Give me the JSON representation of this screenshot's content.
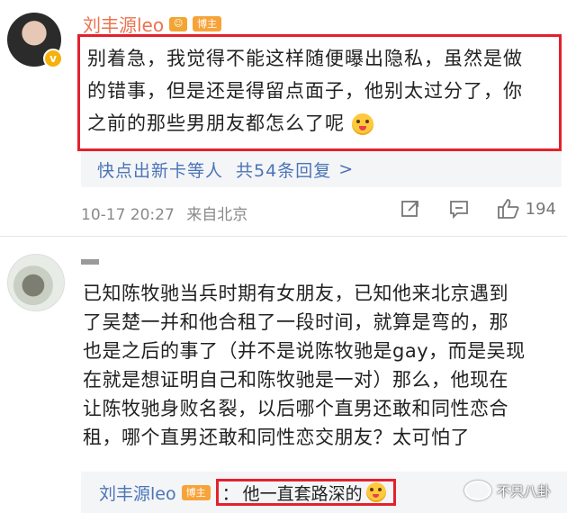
{
  "comment1": {
    "username": "刘丰源leo",
    "blogger_tag": "博主",
    "text_lines": [
      "别着急，我觉得不能这样随便曝出隐私，虽然是做",
      "的错事，但是还是得留点面子，他别太过分了，你",
      "之前的那些男朋友都怎么了呢"
    ],
    "reply_summary": {
      "names": "快点出新卡等人",
      "count_text": "共54条回复",
      "arrow": ">"
    },
    "time": "10-17 20:27",
    "location": "来自北京",
    "like_count": "194",
    "icons": {
      "share": "share-icon",
      "comment": "comment-icon",
      "like": "thumbs-up-icon"
    }
  },
  "comment2": {
    "text_lines": [
      "已知陈牧驰当兵时期有女朋友，已知他来北京遇到",
      "了吴楚一并和他合租了一段时间，就算是弯的，那",
      "也是之后的事了（并不是说陈牧驰是gay，而是吴现",
      "在就是想证明自己和陈牧驰是一对）那么，他现在",
      "让陈牧驰身败名裂，以后哪个直男还敢和同性恋合",
      "租，哪个直男还敢和同性恋交朋友？太可怕了"
    ],
    "sub_reply": {
      "username": "刘丰源leo",
      "tag": "博主",
      "separator": "：",
      "text": "他一直套路深的"
    }
  },
  "watermark": {
    "text": "不只八卦"
  },
  "colors": {
    "username": "#eb7350",
    "link": "#4a74b6",
    "highlight_border": "#e3212d"
  }
}
